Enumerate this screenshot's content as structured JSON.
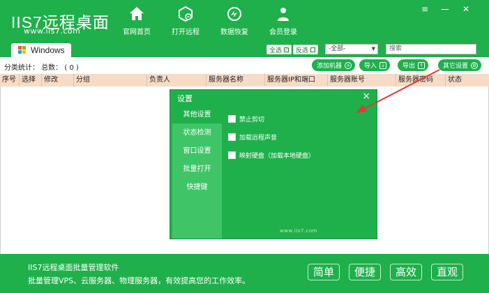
{
  "header": {
    "logo_text": "IIS7远程桌面",
    "logo_url": "www.iis7.com",
    "nav": [
      {
        "label": "官网首页",
        "icon": "home-icon"
      },
      {
        "label": "打开远程",
        "icon": "remote-box-icon"
      },
      {
        "label": "数据恢复",
        "icon": "data-recovery-icon"
      },
      {
        "label": "会员登录",
        "icon": "member-icon"
      }
    ],
    "window_controls": {
      "menu": "≡",
      "minimize": "—",
      "close": "✕"
    },
    "tab_label": "Windows",
    "select_all_label": "全选",
    "invert_label": "反选",
    "group_select_value": "-全部-",
    "search_placeholder": "搜索"
  },
  "toolbar": {
    "stats_label": "分类统计：",
    "total_label": "总数：",
    "total_value": "( 0 )",
    "add_label": "添加机器",
    "import_label": "导入",
    "export_label": "导出",
    "settings_label": "其它设置"
  },
  "table": {
    "columns": [
      "序号",
      "选择",
      "修改",
      "分组",
      "负责人",
      "服务器名称",
      "服务器IP和端口",
      "服务器账号",
      "服务器密码",
      "状态"
    ]
  },
  "dialog": {
    "title": "设置",
    "close": "×",
    "sidebar": [
      "其他设置",
      "状态检测",
      "窗口设置",
      "批量打开",
      "快捷键"
    ],
    "options": [
      "禁止剪切",
      "加载远程声音",
      "映射硬盘（加载本地硬盘）"
    ],
    "footer": "www.iis7.com"
  },
  "footer": {
    "line1": "IIS7远程桌面批量管理软件",
    "line2": "批量管理VPS、云服务器、物理服务器，有效提高您的工作效率。",
    "buttons": [
      "简单",
      "便捷",
      "高效",
      "直观"
    ]
  },
  "colors": {
    "brand_green": "#1fb04b",
    "table_header": "#f6dcc7",
    "annotation_arrow": "#e03a3a"
  }
}
